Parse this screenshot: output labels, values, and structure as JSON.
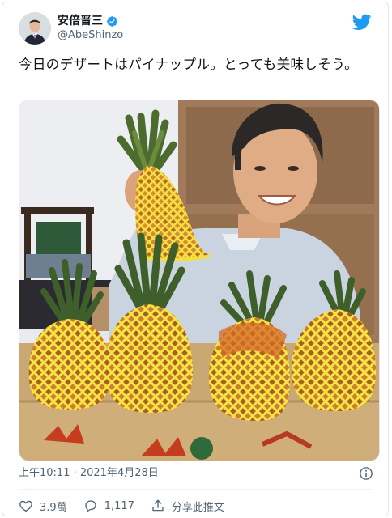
{
  "tweet": {
    "author": {
      "display_name": "安倍晋三",
      "handle": "@AbeShinzo",
      "avatar_icon": "profile-photo",
      "verified_icon": "verified-badge-icon"
    },
    "brand_icon": "twitter-bird-icon",
    "text": "今日のデザートはパイナップル。とっても美味しそう。",
    "media": {
      "type": "photo",
      "subject": "pineapples-on-box"
    },
    "timestamp": "上午10:11 · 2021年4月28日",
    "actions": {
      "like_count": "3.9萬",
      "reply_count": "1,117",
      "share_label": "分享此推文"
    },
    "colors": {
      "accent": "#1d9bf0",
      "secondary_text": "#536471",
      "pineapple_net": "#f3e03c"
    }
  }
}
